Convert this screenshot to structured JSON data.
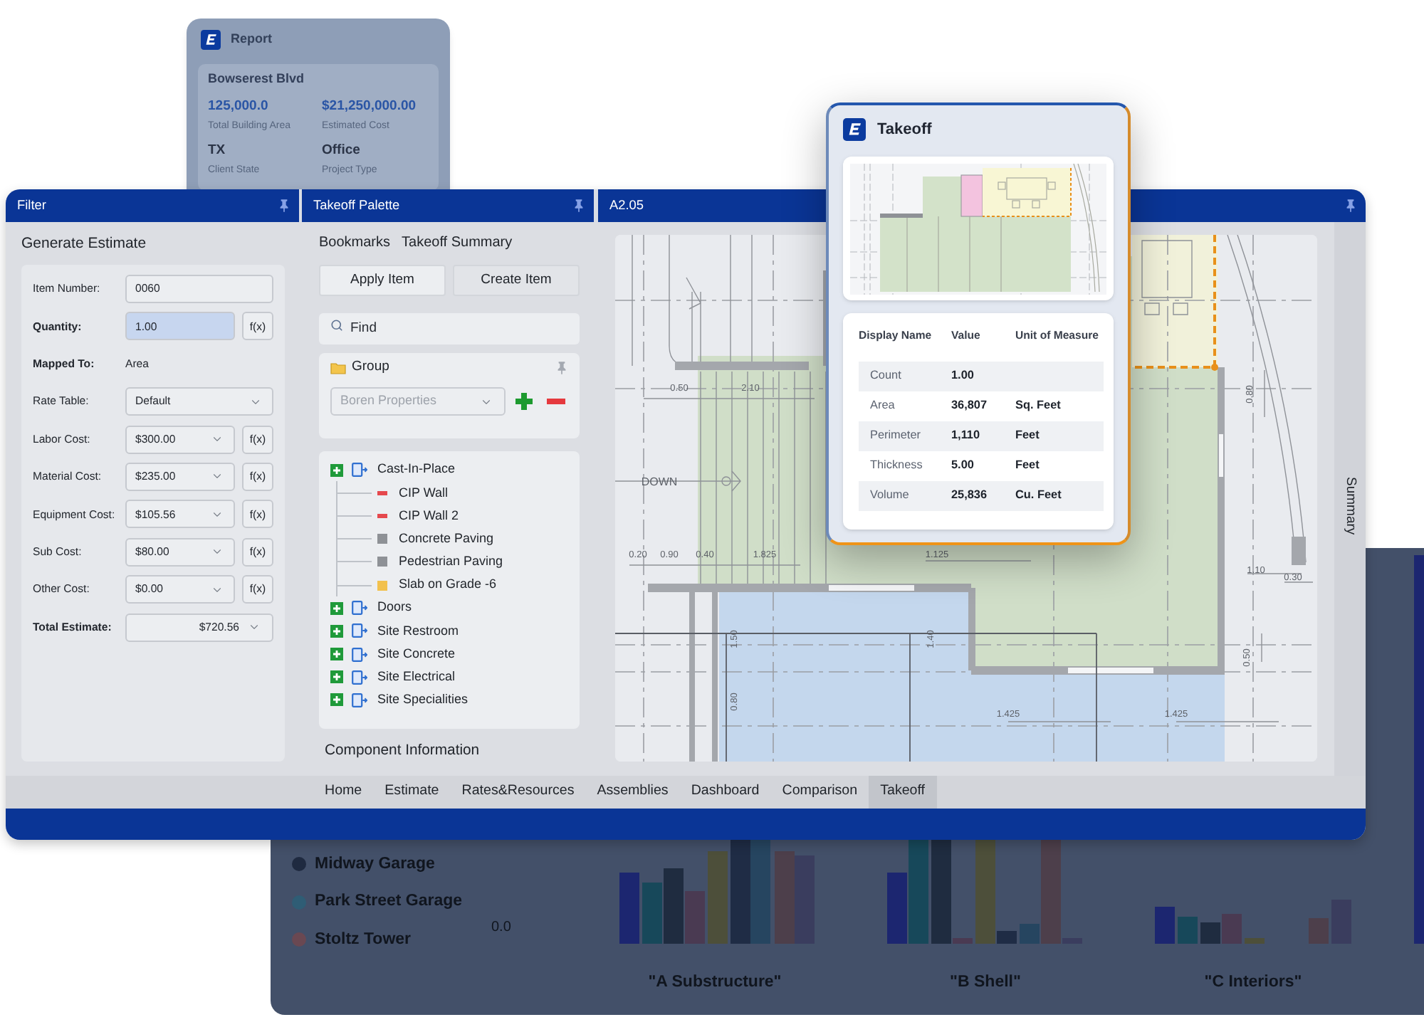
{
  "report_card": {
    "title": "Report",
    "project": "Bowserest Blvd",
    "stats": [
      {
        "value": "125,000.0",
        "label": "Total Building Area",
        "kind": "metric"
      },
      {
        "value": "$21,250,000.00",
        "label": "Estimated Cost",
        "kind": "metric"
      },
      {
        "value": "TX",
        "label": "Client State",
        "kind": "plain"
      },
      {
        "value": "Office",
        "label": "Project Type",
        "kind": "plain"
      }
    ]
  },
  "filter": {
    "title": "Filter",
    "heading": "Generate Estimate",
    "fields": [
      {
        "label": "Item Number:",
        "kind": "input",
        "value": "0060",
        "bold": false,
        "focused": false
      },
      {
        "label": "Quantity:",
        "kind": "input",
        "value": "1.00",
        "button": "f(x)",
        "bold": true,
        "focused": true
      },
      {
        "label": "Mapped To:",
        "kind": "static",
        "value": "Area",
        "bold": true
      },
      {
        "label": "Rate Table:",
        "kind": "select",
        "value": "Default",
        "bold": false,
        "focused": false
      },
      {
        "label": "Labor Cost:",
        "kind": "select",
        "value": "$300.00",
        "button": "f(x)",
        "bold": false,
        "focused": false
      },
      {
        "label": "Material Cost:",
        "kind": "select",
        "value": "$235.00",
        "button": "f(x)",
        "bold": false,
        "focused": false
      },
      {
        "label": "Equipment Cost:",
        "kind": "select",
        "value": "$105.56",
        "button": "f(x)",
        "bold": false,
        "focused": false
      },
      {
        "label": "Sub Cost:",
        "kind": "select",
        "value": "$80.00",
        "button": "f(x)",
        "bold": false,
        "focused": false
      },
      {
        "label": "Other Cost:",
        "kind": "select",
        "value": "$0.00",
        "button": "f(x)",
        "bold": false,
        "focused": false
      },
      {
        "label": "Total Estimate:",
        "kind": "total",
        "value": "$720.56",
        "bold": true,
        "focused": false
      }
    ]
  },
  "palette": {
    "title": "Takeoff Palette",
    "tabs": [
      "Bookmarks",
      "Takeoff Summary"
    ],
    "buttons": [
      "Apply Item",
      "Create Item"
    ],
    "search": {
      "placeholder": "Find"
    },
    "group": {
      "title": "Group",
      "value": "Boren Properties",
      "disabled": true
    },
    "tree": [
      {
        "label": "Cast-In-Place",
        "children": [
          {
            "label": "CIP Wall",
            "kind": "line",
            "color": "#e5484d"
          },
          {
            "label": "CIP Wall 2",
            "kind": "line",
            "color": "#e5484d"
          },
          {
            "label": "Concrete Paving",
            "kind": "area",
            "color": "#8e9196"
          },
          {
            "label": "Pedestrian Paving",
            "kind": "area",
            "color": "#8e9196"
          },
          {
            "label": "Slab on Grade -6",
            "kind": "area",
            "color": "#f2c14e"
          }
        ]
      },
      {
        "label": "Doors"
      },
      {
        "label": "Site Restroom"
      },
      {
        "label": "Site Concrete"
      },
      {
        "label": "Site Electrical"
      },
      {
        "label": "Site Specialities"
      }
    ],
    "footer": "Component Information"
  },
  "drawing": {
    "title": "A2.05",
    "dimension_labels": [
      "0.50",
      "2.10",
      "DOWN",
      "0.20",
      "0.90",
      "0.40",
      "1.825",
      "1.125",
      "1.425",
      "1.425",
      "1.10",
      "0.30",
      "0.80",
      "0.50",
      "1.50",
      "1.40",
      "0.80"
    ],
    "side_tab": "Summary"
  },
  "nav_tabs": [
    {
      "label": "Home",
      "selected": false
    },
    {
      "label": "Estimate",
      "selected": false
    },
    {
      "label": "Rates&Resources",
      "selected": false
    },
    {
      "label": "Assemblies",
      "selected": false
    },
    {
      "label": "Dashboard",
      "selected": false
    },
    {
      "label": "Comparison",
      "selected": false
    },
    {
      "label": "Takeoff",
      "selected": true
    }
  ],
  "takeoff_popup": {
    "title": "Takeoff",
    "columns": [
      "Display Name",
      "Value",
      "Unit of Measure"
    ],
    "rows": [
      {
        "name": "Count",
        "value": "1.00"
      },
      {
        "name": "Area",
        "value": "36,807",
        "unit": "Sq. Feet"
      },
      {
        "name": "Perimeter",
        "value": "1,110",
        "unit": "Feet"
      },
      {
        "name": "Thickness",
        "value": "5.00",
        "unit": "Feet"
      },
      {
        "name": "Volume",
        "value": "25,836",
        "unit": "Cu. Feet"
      }
    ]
  },
  "background_chart": {
    "legend": [
      {
        "name": "Midway Garage",
        "color": "#1f2a40"
      },
      {
        "name": "Park Street Garage",
        "color": "#2f5d75"
      },
      {
        "name": "Stoltz Tower",
        "color": "#6a4852"
      }
    ],
    "axis_label": "0.0",
    "group_labels": [
      "\"A Substructure\"",
      "\"B Shell\"",
      "\"C Interiors\""
    ]
  }
}
